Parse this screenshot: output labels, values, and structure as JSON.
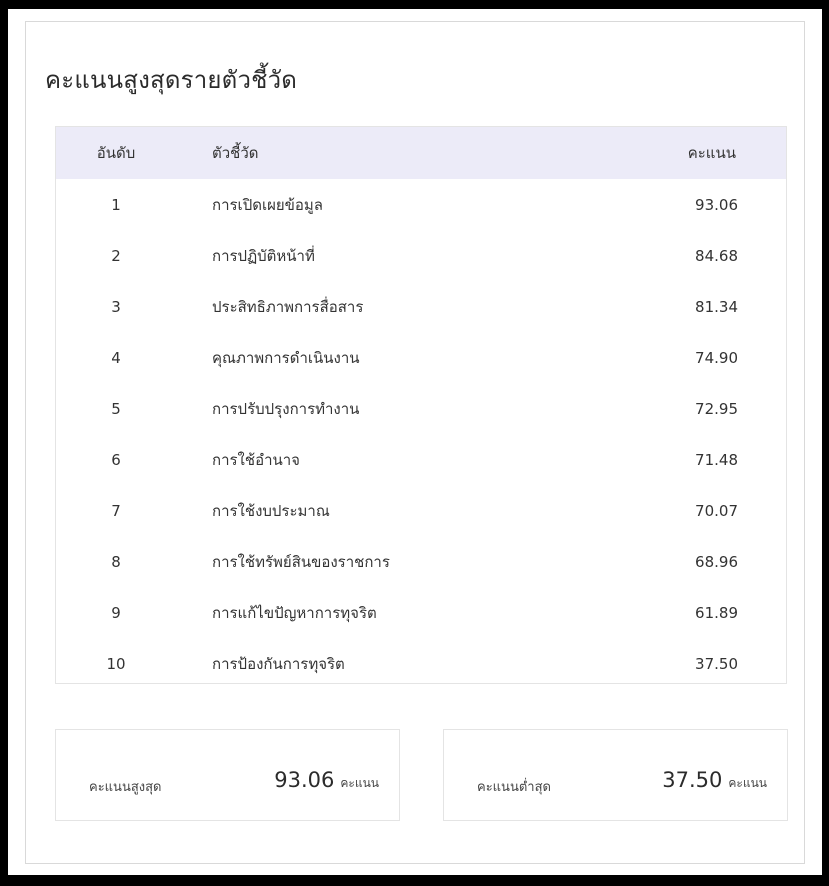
{
  "title": "คะแนนสูงสุดรายตัวชี้วัด",
  "table": {
    "headers": {
      "rank": "อันดับ",
      "indicator": "ตัวชี้วัด",
      "score": "คะแนน"
    },
    "rows": [
      {
        "rank": "1",
        "indicator": "การเปิดเผยข้อมูล",
        "score": "93.06"
      },
      {
        "rank": "2",
        "indicator": "การปฏิบัติหน้าที่",
        "score": "84.68"
      },
      {
        "rank": "3",
        "indicator": "ประสิทธิภาพการสื่อสาร",
        "score": "81.34"
      },
      {
        "rank": "4",
        "indicator": "คุณภาพการดำเนินงาน",
        "score": "74.90"
      },
      {
        "rank": "5",
        "indicator": "การปรับปรุงการทำงาน",
        "score": "72.95"
      },
      {
        "rank": "6",
        "indicator": "การใช้อำนาจ",
        "score": "71.48"
      },
      {
        "rank": "7",
        "indicator": "การใช้งบประมาณ",
        "score": "70.07"
      },
      {
        "rank": "8",
        "indicator": "การใช้ทรัพย์สินของราชการ",
        "score": "68.96"
      },
      {
        "rank": "9",
        "indicator": "การแก้ไขปัญหาการทุจริต",
        "score": "61.89"
      },
      {
        "rank": "10",
        "indicator": "การป้องกันการทุจริต",
        "score": "37.50"
      }
    ]
  },
  "summary": {
    "max": {
      "label": "คะแนนสูงสุด",
      "value": "93.06",
      "unit": "คะแนน"
    },
    "min": {
      "label": "คะแนนต่ำสุด",
      "value": "37.50",
      "unit": "คะแนน"
    }
  }
}
